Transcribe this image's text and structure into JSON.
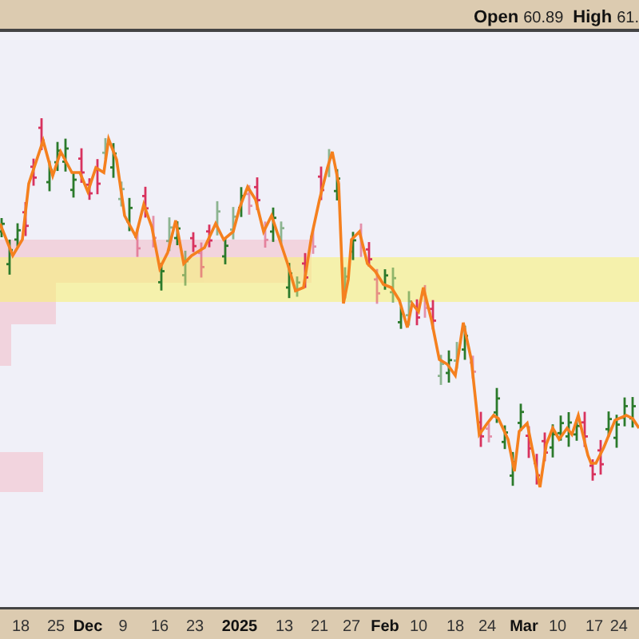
{
  "header": {
    "items": [
      {
        "label": "Open",
        "value": "60.89"
      },
      {
        "label": "High",
        "value": "61."
      }
    ]
  },
  "x_axis": {
    "labels": [
      {
        "text": "18",
        "kind": "day"
      },
      {
        "text": "25",
        "kind": "day"
      },
      {
        "text": "Dec",
        "kind": "period"
      },
      {
        "text": "9",
        "kind": "day"
      },
      {
        "text": "16",
        "kind": "day"
      },
      {
        "text": "23",
        "kind": "day"
      },
      {
        "text": "2025",
        "kind": "period"
      },
      {
        "text": "13",
        "kind": "day"
      },
      {
        "text": "21",
        "kind": "day"
      },
      {
        "text": "27",
        "kind": "day"
      },
      {
        "text": "Feb",
        "kind": "period"
      },
      {
        "text": "10",
        "kind": "day"
      },
      {
        "text": "18",
        "kind": "day"
      },
      {
        "text": "24",
        "kind": "day"
      },
      {
        "text": "Mar",
        "kind": "period"
      },
      {
        "text": "10",
        "kind": "day"
      },
      {
        "text": "17",
        "kind": "day"
      },
      {
        "text": "24",
        "kind": "day"
      }
    ]
  }
}
